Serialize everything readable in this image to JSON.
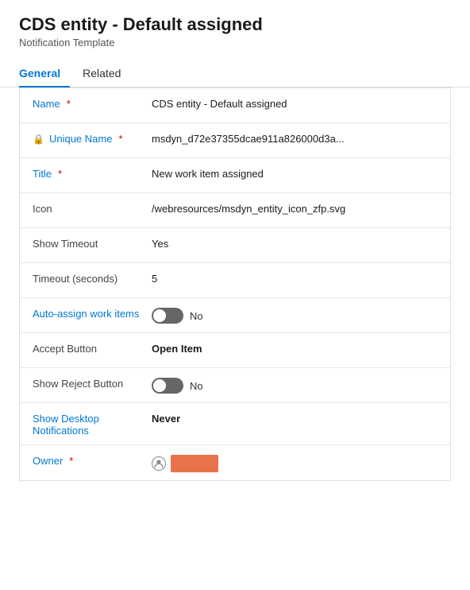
{
  "header": {
    "title": "CDS entity - Default assigned",
    "subtitle": "Notification Template"
  },
  "tabs": [
    {
      "id": "general",
      "label": "General",
      "active": true
    },
    {
      "id": "related",
      "label": "Related",
      "active": false
    }
  ],
  "fields": [
    {
      "id": "name",
      "label": "Name",
      "required": true,
      "locked": false,
      "value": "CDS entity - Default assigned",
      "bold": false,
      "type": "text"
    },
    {
      "id": "unique-name",
      "label": "Unique Name",
      "required": true,
      "locked": true,
      "value": "msdyn_d72e37355dcae911a826000d3a...",
      "bold": false,
      "type": "text"
    },
    {
      "id": "title",
      "label": "Title",
      "required": true,
      "locked": false,
      "value": "New work item assigned",
      "bold": false,
      "type": "text"
    },
    {
      "id": "icon",
      "label": "Icon",
      "required": false,
      "locked": false,
      "value": "/webresources/msdyn_entity_icon_zfp.svg",
      "bold": false,
      "type": "text"
    },
    {
      "id": "show-timeout",
      "label": "Show Timeout",
      "required": false,
      "locked": false,
      "value": "Yes",
      "bold": false,
      "type": "text"
    },
    {
      "id": "timeout-seconds",
      "label": "Timeout (seconds)",
      "required": false,
      "locked": false,
      "value": "5",
      "bold": false,
      "type": "text"
    },
    {
      "id": "auto-assign",
      "label": "Auto-assign work items",
      "required": false,
      "locked": false,
      "value": "No",
      "bold": false,
      "type": "toggle"
    },
    {
      "id": "accept-button",
      "label": "Accept Button",
      "required": false,
      "locked": false,
      "value": "Open Item",
      "bold": true,
      "type": "text"
    },
    {
      "id": "show-reject",
      "label": "Show Reject Button",
      "required": false,
      "locked": false,
      "value": "No",
      "bold": false,
      "type": "toggle"
    },
    {
      "id": "show-desktop",
      "label": "Show Desktop Notifications",
      "required": false,
      "locked": false,
      "value": "Never",
      "bold": true,
      "type": "text"
    },
    {
      "id": "owner",
      "label": "Owner",
      "required": true,
      "locked": false,
      "value": "",
      "bold": false,
      "type": "owner"
    }
  ]
}
